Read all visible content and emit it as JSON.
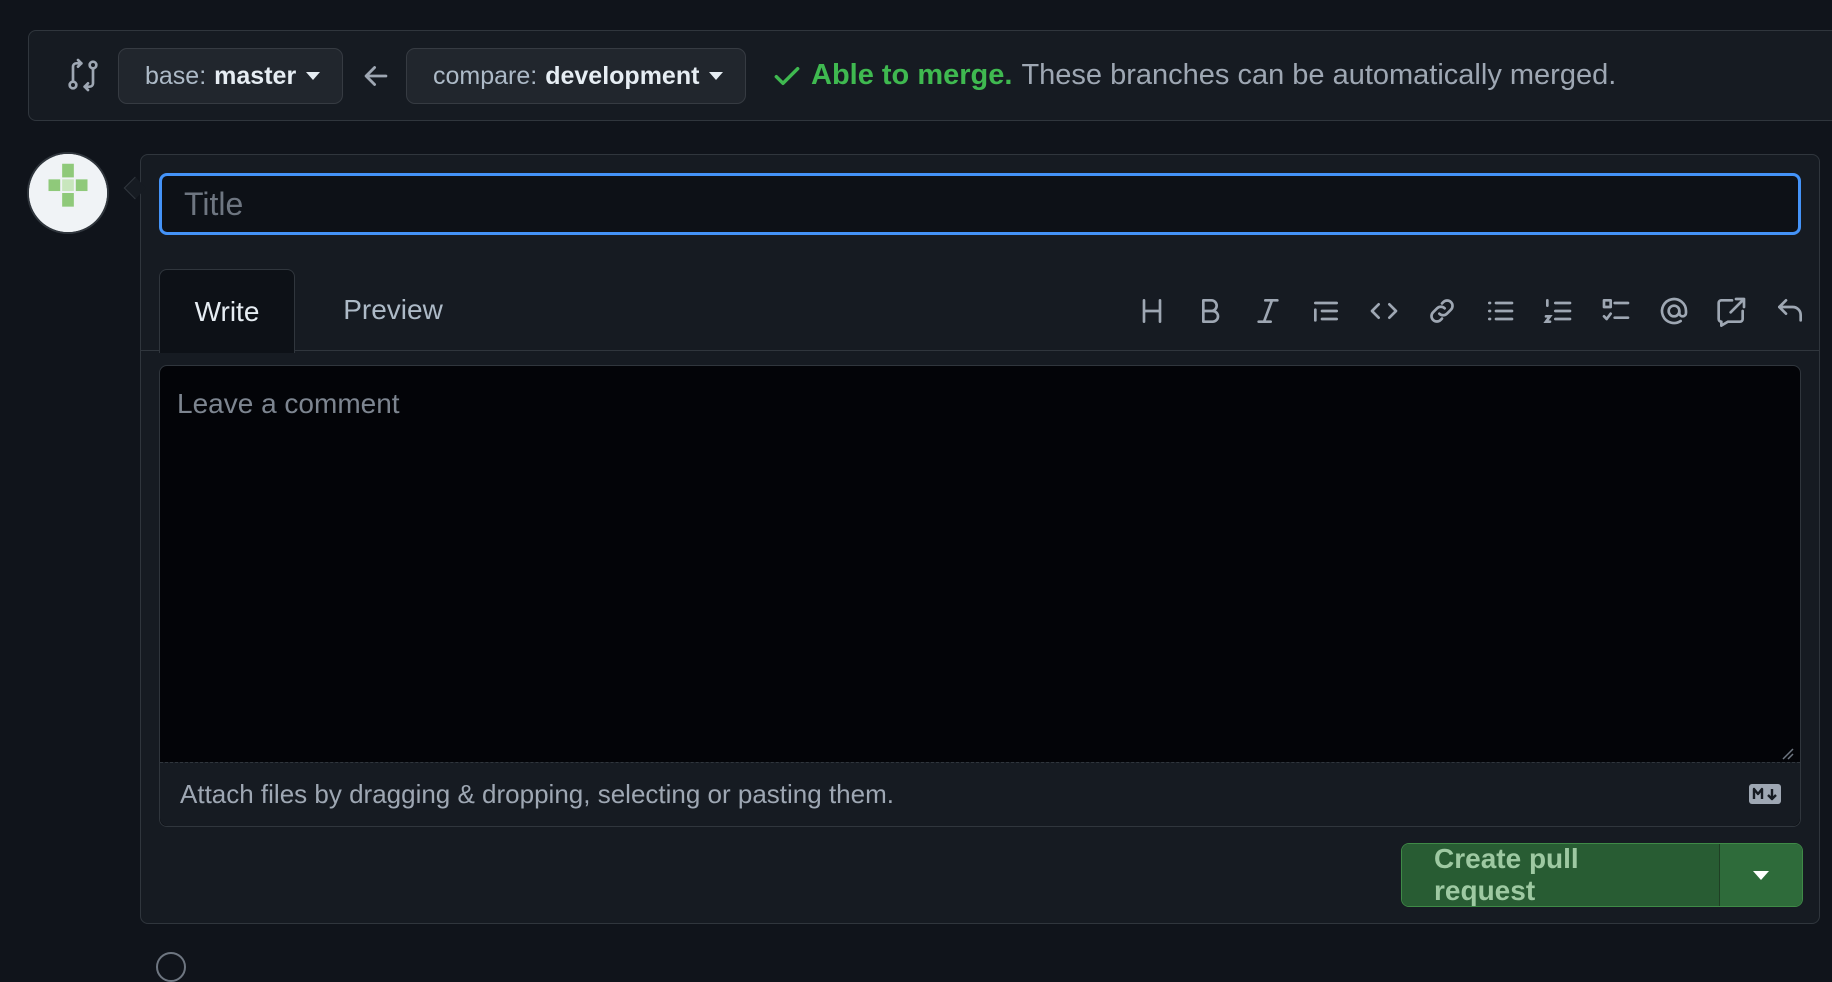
{
  "compare": {
    "base_prefix": "base:",
    "base_value": "master",
    "compare_prefix": "compare:",
    "compare_value": "development",
    "merge_ok": "Able to merge.",
    "merge_msg": "These branches can be automatically merged."
  },
  "form": {
    "title_placeholder": "Title",
    "tabs": [
      {
        "label": "Write",
        "selected": true
      },
      {
        "label": "Preview",
        "selected": false
      }
    ],
    "toolbar_icons": [
      "heading-icon",
      "bold-icon",
      "italic-icon",
      "quote-icon",
      "code-icon",
      "link-icon",
      "bulleted-list-icon",
      "numbered-list-icon",
      "task-list-icon",
      "mention-icon",
      "cross-reference-icon",
      "reply-icon"
    ],
    "comment_placeholder": "Leave a comment",
    "attach_text": "Attach files by dragging & dropping, selecting or pasting them.",
    "submit_label": "Create pull request"
  },
  "colors": {
    "accent_blue": "#4493f8",
    "merge_green": "#3fb950",
    "button_green": "#285c33"
  }
}
